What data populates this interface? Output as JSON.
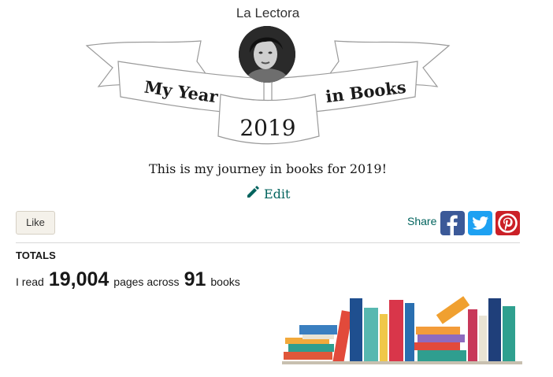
{
  "header": {
    "username": "La Lectora",
    "banner_left": "My Year",
    "banner_right": "in Books",
    "year": "2019"
  },
  "description": "This is my journey in books for 2019!",
  "edit_label": "Edit",
  "actions": {
    "like_label": "Like",
    "share_label": "Share",
    "share_icons": [
      "facebook-icon",
      "twitter-icon",
      "pinterest-icon"
    ]
  },
  "totals": {
    "heading": "TOTALS",
    "prefix": "I read",
    "pages": "19,004",
    "middle": "pages across",
    "books": "91",
    "suffix": "books"
  },
  "colors": {
    "accent": "#00635d",
    "like_bg": "#f4f1ea",
    "facebook": "#3b5998",
    "twitter": "#1da1f2",
    "pinterest": "#cb2027"
  }
}
